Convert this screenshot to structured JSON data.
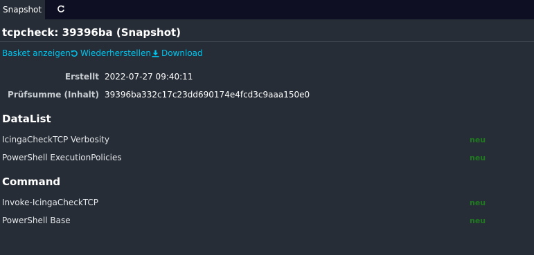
{
  "tabs": {
    "active_label": "Snapshot"
  },
  "page": {
    "title": "tcpcheck: 39396ba (Snapshot)"
  },
  "actions": {
    "show_basket": "Basket anzeigen",
    "restore": "Wiederherstellen",
    "download": "Download"
  },
  "meta": {
    "created_label": "Erstellt",
    "created_value": "2022-07-27 09:40:11",
    "checksum_label": "Prüfsumme (Inhalt)",
    "checksum_value": "39396ba332c17c23dd690174e4fcd3c9aaa150e0"
  },
  "sections": [
    {
      "heading": "DataList",
      "rows": [
        {
          "name": "IcingaCheckTCP Verbosity",
          "status": "neu"
        },
        {
          "name": "PowerShell ExecutionPolicies",
          "status": "neu"
        }
      ]
    },
    {
      "heading": "Command",
      "rows": [
        {
          "name": "Invoke-IcingaCheckTCP",
          "status": "neu"
        },
        {
          "name": "PowerShell Base",
          "status": "neu"
        }
      ]
    }
  ],
  "icons": {
    "refresh": "refresh-icon",
    "restore": "rotate-icon",
    "download": "download-icon"
  },
  "colors": {
    "background": "#262d36",
    "tabbar": "#0f0f24",
    "link": "#00c3ed",
    "status_new": "#1f7a1f"
  }
}
